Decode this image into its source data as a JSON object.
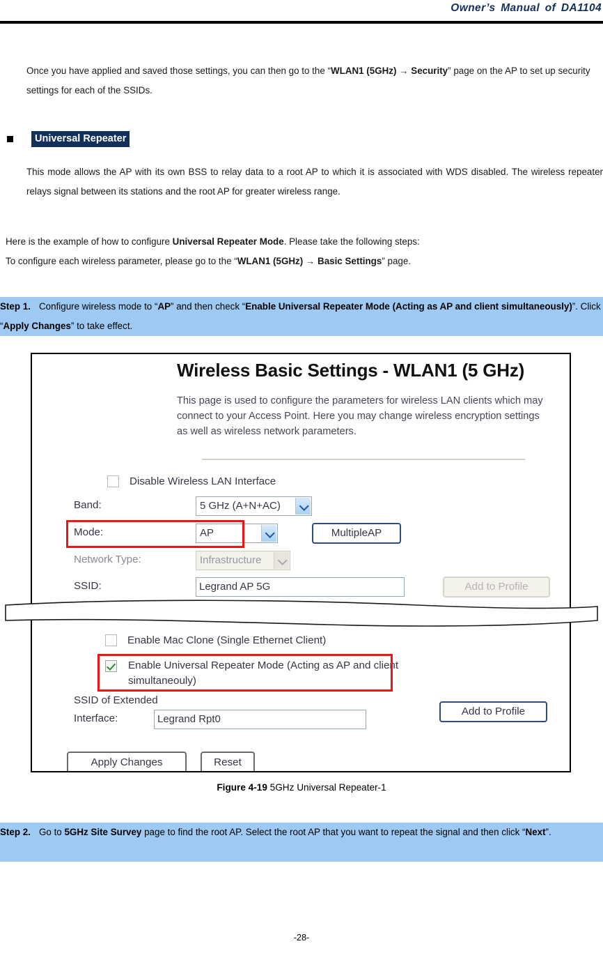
{
  "header": {
    "title": "Owner’s Manual of DA1104"
  },
  "intro": {
    "text_1": "Once you have applied and saved those settings, you can then go to the “",
    "bold_1": "WLAN1 (5GHz) → Security",
    "text_2": "” page on the AP to set up security settings for each of the SSIDs."
  },
  "section": {
    "bullet_heading": "Universal Repeater",
    "description": "This mode allows the AP with its own BSS to relay data to a root AP to which it is associated with WDS disabled. The wireless repeater relays signal between its stations and the root AP for greater wireless range."
  },
  "example": {
    "line1_text_1": "Here is the example of how to configure ",
    "line1_bold": "Universal Repeater Mode",
    "line1_text_2": ". Please take the following steps:",
    "line2_text_1": "To configure each wireless parameter, please go to the “",
    "line2_bold": "WLAN1 (5GHz) → Basic Settings",
    "line2_text_2": "” page."
  },
  "step1": {
    "label": "Step 1.",
    "text_1": "Configure wireless mode to “",
    "bold_1": "AP",
    "text_2": "” and then check “",
    "bold_2": "Enable Universal Repeater Mode (Acting as AP and client simultaneously)",
    "text_3": "”. Click “",
    "bold_3": "Apply Changes",
    "text_4": "” to take effect."
  },
  "step2": {
    "label": "Step 2.",
    "text_1": "Go to ",
    "bold_1": "5GHz Site Survey",
    "text_2": " page to find the root AP. Select the root AP that you want to repeat the signal and then click “",
    "bold_2": "Next",
    "text_3": "”."
  },
  "screenshot": {
    "title": "Wireless Basic Settings - WLAN1 (5 GHz)",
    "description": "This page is used to configure the parameters for wireless LAN clients which may connect to your Access Point. Here you may change wireless encryption settings as well as wireless network parameters.",
    "disable_wlan_label": "Disable Wireless LAN Interface",
    "disable_wlan_checked": false,
    "band_label": "Band:",
    "band_value": "5 GHz (A+N+AC)",
    "mode_label": "Mode:",
    "mode_value": "AP",
    "multiple_ap_button": "MultipleAP",
    "network_type_label": "Network Type:",
    "network_type_value": "Infrastructure",
    "ssid_label": "SSID:",
    "ssid_value": "Legrand AP 5G",
    "add_to_profile_top_button": "Add to Profile",
    "mac_clone_label": "Enable Mac Clone (Single Ethernet Client)",
    "mac_clone_checked": false,
    "universal_repeater_label": "Enable Universal Repeater Mode (Acting as AP and client simultaneouly)",
    "universal_repeater_checked": true,
    "ssid_ext_label_line1": "SSID of Extended",
    "ssid_ext_label_line2": "Interface:",
    "ssid_ext_value": "Legrand Rpt0",
    "add_to_profile_bottom_button": "Add to Profile",
    "apply_changes_button": "Apply Changes",
    "reset_button": "Reset"
  },
  "figure": {
    "number": "Figure 4-19",
    "caption": "5GHz Universal Repeater-1"
  },
  "footer": {
    "page_number": "-28-"
  },
  "colors": {
    "header_navy": "#12305c",
    "highlight_blue": "#9ec9f2",
    "red_annotation": "#ef1414",
    "heading_bg": "#12305c"
  }
}
